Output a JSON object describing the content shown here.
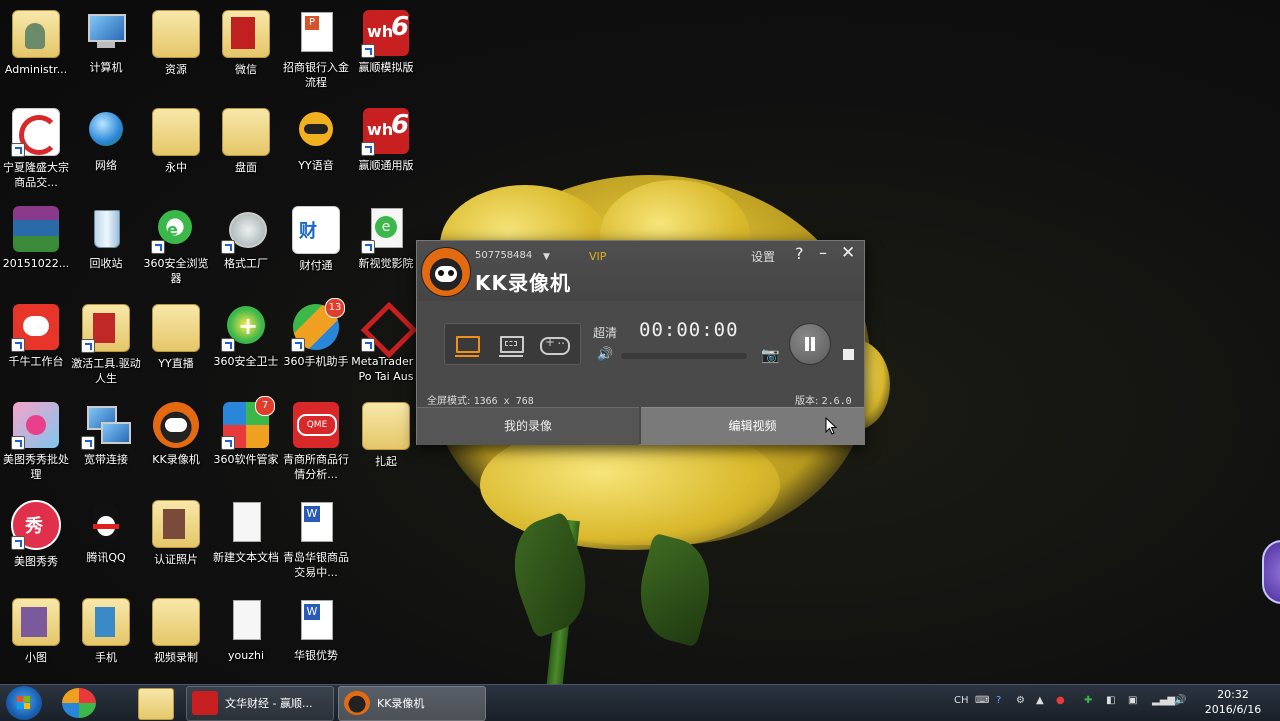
{
  "desktop_icons": [
    {
      "label": "Administr..."
    },
    {
      "label": "计算机"
    },
    {
      "label": "资源"
    },
    {
      "label": "微信"
    },
    {
      "label": "招商银行入金流程"
    },
    {
      "label": "赢顺模拟版"
    },
    {
      "label": "宁夏隆盛大宗商品交..."
    },
    {
      "label": "网络"
    },
    {
      "label": "永中"
    },
    {
      "label": "盘面"
    },
    {
      "label": "YY语音"
    },
    {
      "label": "赢顺通用版"
    },
    {
      "label": "20151022..."
    },
    {
      "label": "回收站"
    },
    {
      "label": "360安全浏览器"
    },
    {
      "label": "格式工厂"
    },
    {
      "label": "财付通"
    },
    {
      "label": "新视觉影院"
    },
    {
      "label": "千牛工作台"
    },
    {
      "label": "激活工具.驱动人生"
    },
    {
      "label": "YY直播"
    },
    {
      "label": "360安全卫士"
    },
    {
      "label": "360手机助手",
      "badge": "13"
    },
    {
      "label": "MetaTrader - Po Tai Aus"
    },
    {
      "label": "美图秀秀批处理"
    },
    {
      "label": "宽带连接"
    },
    {
      "label": "KK录像机"
    },
    {
      "label": "360软件管家",
      "badge": "7"
    },
    {
      "label": "青商所商品行情分析..."
    },
    {
      "label": "扎起"
    },
    {
      "label": "美图秀秀"
    },
    {
      "label": "腾讯QQ"
    },
    {
      "label": "认证照片"
    },
    {
      "label": "新建文本文档"
    },
    {
      "label": "青岛华银商品交易中..."
    },
    {
      "label": "小图"
    },
    {
      "label": "手机"
    },
    {
      "label": "视频录制"
    },
    {
      "label": "youzhi"
    },
    {
      "label": "华银优势"
    }
  ],
  "kk_window": {
    "user_id": "507758484",
    "vip": "VIP",
    "brand": "KK录像机",
    "settings": "设置",
    "help": "?",
    "minimize": "–",
    "close": "✕",
    "quality": "超清",
    "timer": "00:00:00",
    "fullscreen_label": "全屏模式:",
    "fullscreen_value": "1366 x 768",
    "version_label": "版本:",
    "version_value": "2.6.0",
    "my_recordings": "我的录像",
    "edit_video": "编辑视频",
    "volume_level": 0
  },
  "taskbar": {
    "tasks": [
      {
        "label": "文华财经 - 赢顺..."
      },
      {
        "label": "KK录像机"
      }
    ],
    "tray_lang": "CH",
    "clock_time": "20:32",
    "clock_date": "2016/6/16"
  },
  "colors": {
    "accent_orange": "#f0901c",
    "vip_gold": "#e0b020",
    "window_bg": "#4a4a4a"
  }
}
